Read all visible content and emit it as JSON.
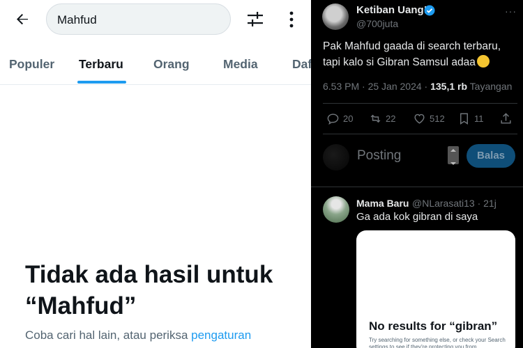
{
  "left": {
    "search": {
      "value": "Mahfud"
    },
    "tabs": [
      {
        "label": "Populer"
      },
      {
        "label": "Terbaru"
      },
      {
        "label": "Orang"
      },
      {
        "label": "Media"
      },
      {
        "label": "Daf"
      }
    ],
    "empty": {
      "title": "Tidak ada hasil untuk “Mahfud”",
      "desc_prefix": "Coba cari hal lain, atau periksa ",
      "desc_link": "pengaturan"
    },
    "icons": {
      "back": "arrow-left-icon",
      "filter": "sliders-icon",
      "more": "more-vertical-icon"
    }
  },
  "right": {
    "tweet": {
      "name": "Ketiban Uang!",
      "handle": "@700juta",
      "more": "···",
      "text_line1": "Pak Mahfud gaada di search terbaru,",
      "text_line2": "tapi kalo si Gibran Samsul adaa",
      "time": "6.53 PM · 25 Jan 2024 · ",
      "views": "135,1 rb",
      "views_label": " Tayangan",
      "counts": {
        "reply": "20",
        "retweet": "22",
        "like": "512",
        "bookmark": "11"
      }
    },
    "compose": {
      "placeholder": "Posting",
      "button": "Balas"
    },
    "reply": {
      "name": "Mama Baru",
      "handle": "@NLarasati13 · 21j",
      "text": "Ga ada kok gibran di saya",
      "card_title": "No results for “gibran”",
      "card_sub": "Try searching for something else, or check your Search settings to see if they're protecting you from"
    },
    "colors": {
      "bg": "#000000",
      "accent": "#1d9bf0",
      "button": "#0f4e78"
    }
  }
}
